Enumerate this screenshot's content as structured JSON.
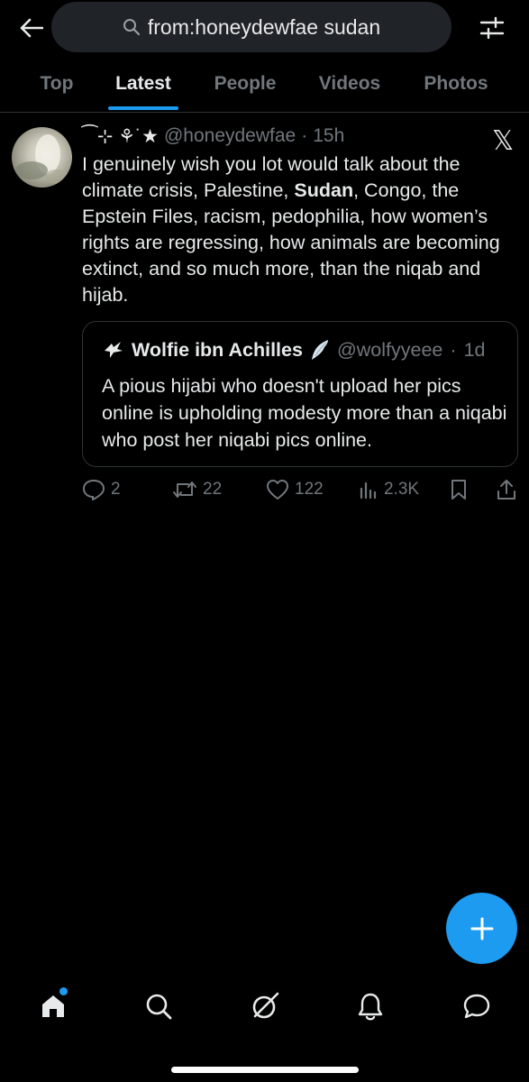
{
  "search": {
    "query": "from:honeydewfae sudan"
  },
  "tabs": [
    {
      "label": "Top"
    },
    {
      "label": "Latest"
    },
    {
      "label": "People"
    },
    {
      "label": "Videos"
    },
    {
      "label": "Photos"
    }
  ],
  "active_tab": "Latest",
  "tweet": {
    "display_name": "⁀⊹ ⚘˙★",
    "handle": "@honeydewfae",
    "separator": "·",
    "time": "15h",
    "text_before": "I genuinely wish you lot would talk about the climate crisis, Palestine, ",
    "text_bold": "Sudan",
    "text_after": ", Congo, the Epstein Files, racism, pedophilia, how women’s rights are regressing, how animals are becoming extinct, and so much more, than the niqab and hijab.",
    "quote": {
      "name": "Wolfie ibn Achilles",
      "handle": "@wolfyyeee",
      "separator": "·",
      "time": "1d",
      "text": "A pious hijabi who doesn't upload her pics online is upholding modesty more than a niqabi who post her niqabi pics online."
    },
    "stats": {
      "replies": "2",
      "reposts": "22",
      "likes": "122",
      "views": "2.3K"
    }
  },
  "colors": {
    "background": "#000000",
    "accent": "#1d9bf0",
    "secondary_text": "#71767b",
    "border": "#2f3336"
  }
}
